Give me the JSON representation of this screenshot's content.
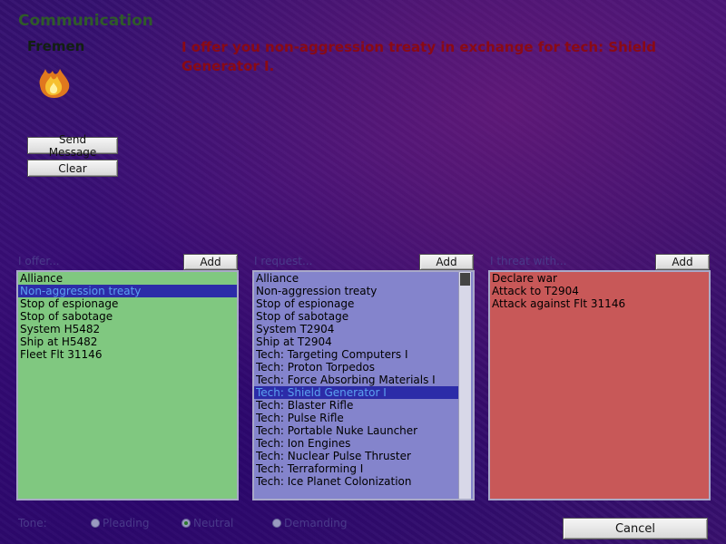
{
  "window": {
    "title": "Communication"
  },
  "race": {
    "name": "Fremen",
    "icon": "fire-icon"
  },
  "message": {
    "text": "I offer you non-aggression treaty in exchange for tech: Shield Generator I."
  },
  "actions": {
    "send_label": "Send Message",
    "clear_label": "Clear",
    "cancel_label": "Cancel"
  },
  "offer": {
    "label": "I offer...",
    "add_label": "Add",
    "color": "#80c880",
    "items": [
      "Alliance",
      "Non-aggression treaty",
      "Stop of espionage",
      "Stop of sabotage",
      "System H5482",
      "Ship at H5482",
      "Fleet Flt 31146"
    ],
    "selected": "Non-aggression treaty"
  },
  "request": {
    "label": "I request...",
    "add_label": "Add",
    "color": "#8484cc",
    "items": [
      "Alliance",
      "Non-aggression treaty",
      "Stop of espionage",
      "Stop of sabotage",
      "System T2904",
      "Ship at T2904",
      "Tech: Targeting Computers I",
      "Tech: Proton Torpedos",
      "Tech: Force Absorbing Materials I",
      "Tech: Shield Generator I",
      "Tech: Blaster Rifle",
      "Tech: Pulse Rifle",
      "Tech: Portable Nuke Launcher",
      "Tech: Ion Engines",
      "Tech: Nuclear Pulse Thruster",
      "Tech: Terraforming I",
      "Tech: Ice Planet Colonization"
    ],
    "selected": "Tech: Shield Generator I"
  },
  "threat": {
    "label": "I threat with...",
    "add_label": "Add",
    "color": "#c85858",
    "items": [
      "Declare war",
      "Attack to T2904",
      "Attack against Flt 31146"
    ]
  },
  "tone": {
    "label": "Tone:",
    "options": [
      "Pleading",
      "Neutral",
      "Demanding"
    ],
    "selected": "Neutral"
  }
}
